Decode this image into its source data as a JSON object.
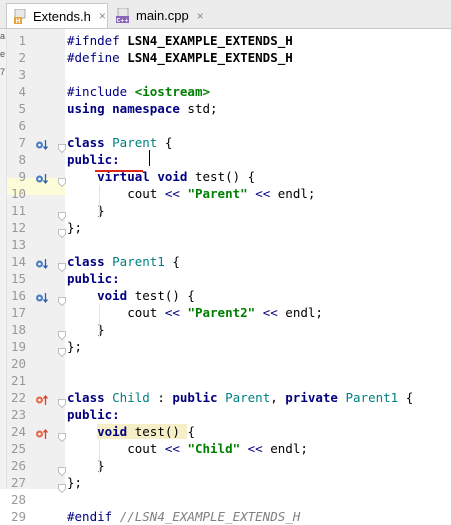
{
  "tabs": [
    {
      "label": "Extends.h",
      "close": "×",
      "icon": "h-file-icon",
      "badge": "H"
    },
    {
      "label": "main.cpp",
      "close": "×",
      "icon": "cpp-file-icon",
      "badge": "C++"
    }
  ],
  "left_strip": [
    "a",
    "e",
    "7"
  ],
  "lines": [
    {
      "n": "1",
      "tokens": [
        {
          "t": "#ifndef ",
          "c": "pp"
        },
        {
          "t": "LSN4_EXAMPLE_EXTENDS_H",
          "c": "macro"
        }
      ]
    },
    {
      "n": "2",
      "tokens": [
        {
          "t": "#define ",
          "c": "pp"
        },
        {
          "t": "LSN4_EXAMPLE_EXTENDS_H",
          "c": "macro"
        }
      ]
    },
    {
      "n": "3",
      "tokens": []
    },
    {
      "n": "4",
      "tokens": [
        {
          "t": "#include ",
          "c": "pp"
        },
        {
          "t": "<iostream>",
          "c": "str"
        }
      ]
    },
    {
      "n": "5",
      "tokens": [
        {
          "t": "using namespace ",
          "c": "kw"
        },
        {
          "t": "std;",
          "c": "fn"
        }
      ]
    },
    {
      "n": "6",
      "tokens": []
    },
    {
      "n": "7",
      "tokens": [
        {
          "t": "class ",
          "c": "kw"
        },
        {
          "t": "Parent",
          "c": "cls"
        },
        {
          "t": " {",
          "c": "fn"
        }
      ]
    },
    {
      "n": "8",
      "tokens": [
        {
          "t": "public:",
          "c": "kw"
        }
      ]
    },
    {
      "n": "9",
      "tokens": [
        {
          "t": "    ",
          "c": "fn"
        },
        {
          "t": "virtual",
          "c": "kw"
        },
        {
          "t": " ",
          "c": "fn"
        },
        {
          "t": "void",
          "c": "kw"
        },
        {
          "t": " test() {",
          "c": "fn"
        }
      ]
    },
    {
      "n": "10",
      "tokens": [
        {
          "t": "        cout ",
          "c": "fn"
        },
        {
          "t": "<<",
          "c": "pp"
        },
        {
          "t": " ",
          "c": "fn"
        },
        {
          "t": "\"Parent\"",
          "c": "str"
        },
        {
          "t": " ",
          "c": "fn"
        },
        {
          "t": "<<",
          "c": "pp"
        },
        {
          "t": " endl;",
          "c": "fn"
        }
      ]
    },
    {
      "n": "11",
      "tokens": [
        {
          "t": "    }",
          "c": "fn"
        }
      ]
    },
    {
      "n": "12",
      "tokens": [
        {
          "t": "};",
          "c": "fn"
        }
      ]
    },
    {
      "n": "13",
      "tokens": []
    },
    {
      "n": "14",
      "tokens": [
        {
          "t": "class ",
          "c": "kw"
        },
        {
          "t": "Parent1",
          "c": "cls"
        },
        {
          "t": " {",
          "c": "fn"
        }
      ]
    },
    {
      "n": "15",
      "tokens": [
        {
          "t": "public:",
          "c": "kw"
        }
      ]
    },
    {
      "n": "16",
      "tokens": [
        {
          "t": "    ",
          "c": "fn"
        },
        {
          "t": "void",
          "c": "kw"
        },
        {
          "t": " test() {",
          "c": "fn"
        }
      ]
    },
    {
      "n": "17",
      "tokens": [
        {
          "t": "        cout ",
          "c": "fn"
        },
        {
          "t": "<<",
          "c": "pp"
        },
        {
          "t": " ",
          "c": "fn"
        },
        {
          "t": "\"Parent2\"",
          "c": "str"
        },
        {
          "t": " ",
          "c": "fn"
        },
        {
          "t": "<<",
          "c": "pp"
        },
        {
          "t": " endl;",
          "c": "fn"
        }
      ]
    },
    {
      "n": "18",
      "tokens": [
        {
          "t": "    }",
          "c": "fn"
        }
      ]
    },
    {
      "n": "19",
      "tokens": [
        {
          "t": "};",
          "c": "fn"
        }
      ]
    },
    {
      "n": "20",
      "tokens": []
    },
    {
      "n": "21",
      "tokens": []
    },
    {
      "n": "22",
      "tokens": [
        {
          "t": "class ",
          "c": "kw"
        },
        {
          "t": "Child",
          "c": "cls"
        },
        {
          "t": " : ",
          "c": "fn"
        },
        {
          "t": "public ",
          "c": "kw"
        },
        {
          "t": "Parent",
          "c": "cls"
        },
        {
          "t": ", ",
          "c": "fn"
        },
        {
          "t": "private ",
          "c": "kw"
        },
        {
          "t": "Parent1",
          "c": "cls"
        },
        {
          "t": " {",
          "c": "fn"
        }
      ]
    },
    {
      "n": "23",
      "tokens": [
        {
          "t": "public:",
          "c": "kw"
        }
      ]
    },
    {
      "n": "24",
      "tokens": [
        {
          "t": "    ",
          "c": "fn"
        },
        {
          "t": "void",
          "c": "kw hl"
        },
        {
          "t": " test() ",
          "c": "fn hl"
        },
        {
          "t": "{",
          "c": "fn"
        }
      ]
    },
    {
      "n": "25",
      "tokens": [
        {
          "t": "        cout ",
          "c": "fn"
        },
        {
          "t": "<<",
          "c": "pp"
        },
        {
          "t": " ",
          "c": "fn"
        },
        {
          "t": "\"Child\"",
          "c": "str"
        },
        {
          "t": " ",
          "c": "fn"
        },
        {
          "t": "<<",
          "c": "pp"
        },
        {
          "t": " endl;",
          "c": "fn"
        }
      ]
    },
    {
      "n": "26",
      "tokens": [
        {
          "t": "    }",
          "c": "fn"
        }
      ]
    },
    {
      "n": "27",
      "tokens": [
        {
          "t": "};",
          "c": "fn"
        }
      ]
    },
    {
      "n": "28",
      "tokens": []
    },
    {
      "n": "29",
      "tokens": [
        {
          "t": "#endif ",
          "c": "pp"
        },
        {
          "t": "//LSN4_EXAMPLE_EXTENDS_H",
          "c": "cmt"
        }
      ]
    }
  ],
  "markers": [
    {
      "line": 7,
      "kind": "implemented-down-icon"
    },
    {
      "line": 9,
      "kind": "implemented-down-icon"
    },
    {
      "line": 14,
      "kind": "implemented-down-icon"
    },
    {
      "line": 16,
      "kind": "implemented-down-icon"
    },
    {
      "line": 22,
      "kind": "overrides-up-icon"
    },
    {
      "line": 24,
      "kind": "overrides-up-icon"
    }
  ],
  "folds": [
    7,
    9,
    11,
    12,
    14,
    16,
    18,
    19,
    22,
    24,
    26,
    27
  ],
  "colors": {
    "keyword": "#000080",
    "string": "#008000",
    "class": "#008080",
    "comment": "#808080",
    "error_underline": "#e0271b",
    "current_line": "#fcfcd8"
  }
}
